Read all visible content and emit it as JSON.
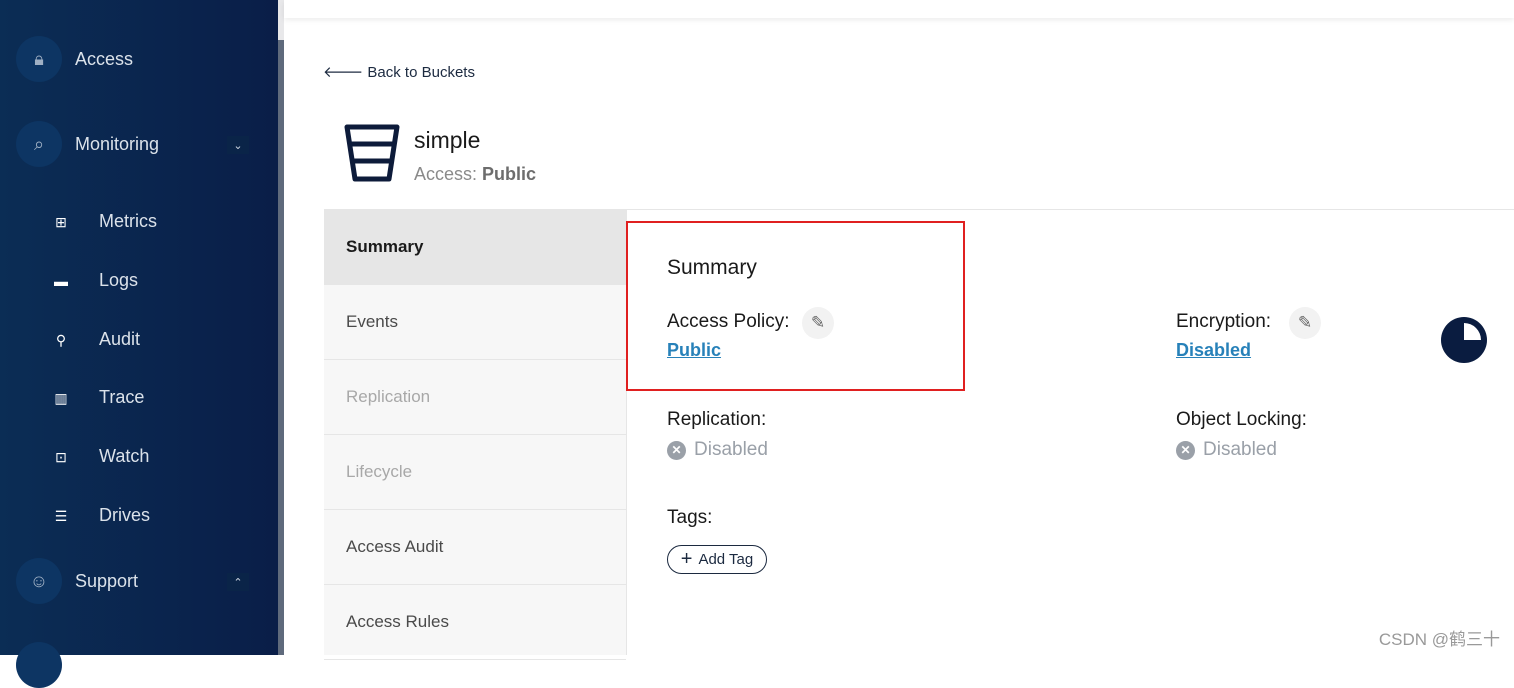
{
  "sidebar": {
    "access": "Access",
    "monitoring": "Monitoring",
    "support": "Support",
    "items": [
      {
        "label": "Metrics",
        "icon": "grid-icon"
      },
      {
        "label": "Logs",
        "icon": "logs-icon"
      },
      {
        "label": "Audit",
        "icon": "audit-icon"
      },
      {
        "label": "Trace",
        "icon": "trace-icon"
      },
      {
        "label": "Watch",
        "icon": "watch-icon"
      },
      {
        "label": "Drives",
        "icon": "drives-icon"
      }
    ]
  },
  "back": "Back to Buckets",
  "bucket": {
    "name": "simple",
    "access_label": "Access:",
    "access_value": "Public"
  },
  "tabs": [
    "Summary",
    "Events",
    "Replication",
    "Lifecycle",
    "Access Audit",
    "Access Rules"
  ],
  "summary": {
    "title": "Summary",
    "access_policy_label": "Access Policy:",
    "access_policy_value": "Public",
    "encryption_label": "Encryption:",
    "encryption_value": "Disabled",
    "replication_label": "Replication:",
    "replication_value": "Disabled",
    "object_locking_label": "Object Locking:",
    "object_locking_value": "Disabled",
    "tags_label": "Tags:",
    "add_tag": "Add Tag"
  },
  "usage_fraction": 0.25,
  "watermark": "CSDN @鹤三十"
}
